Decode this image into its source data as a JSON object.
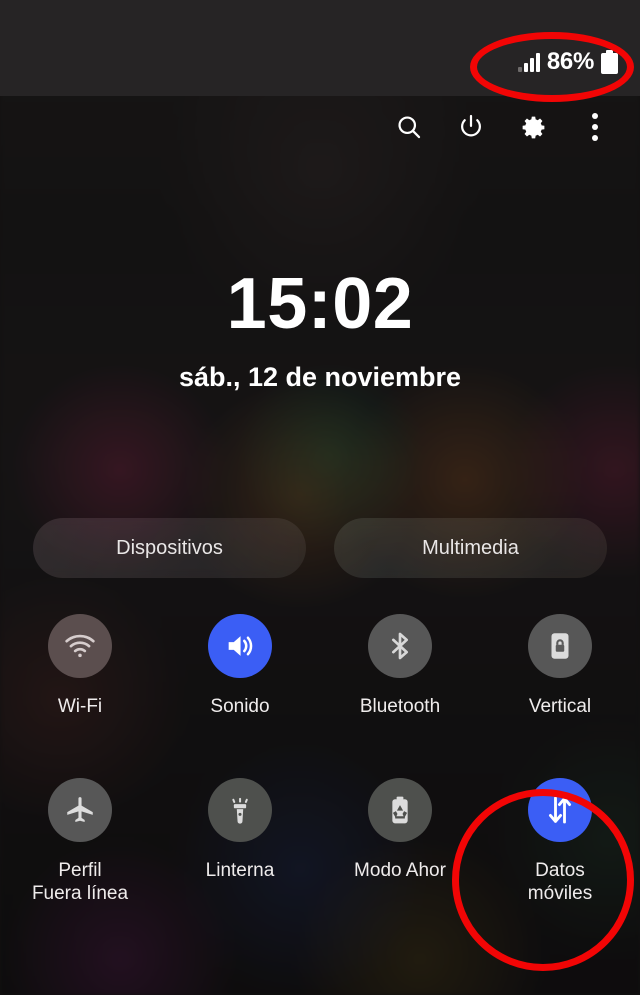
{
  "status_bar": {
    "signal_icon": "signal-bars-icon",
    "battery_percent": "86%",
    "battery_icon": "battery-full-icon"
  },
  "header": {
    "icons": [
      {
        "name": "search-icon",
        "label": "Buscar"
      },
      {
        "name": "power-icon",
        "label": "Apagar"
      },
      {
        "name": "gear-icon",
        "label": "Ajustes"
      },
      {
        "name": "more-options-icon",
        "label": "Más opciones"
      }
    ]
  },
  "clock": {
    "time": "15:02",
    "date": "sáb., 12 de noviembre"
  },
  "pills": [
    {
      "label": "Dispositivos",
      "name": "devices-pill"
    },
    {
      "label": "Multimedia",
      "name": "media-pill"
    }
  ],
  "quick_settings": [
    {
      "label": "Wi-Fi",
      "icon": "wifi-icon",
      "state": "off",
      "style": "warm"
    },
    {
      "label": "Sonido",
      "icon": "volume-icon",
      "state": "on",
      "style": "on"
    },
    {
      "label": "Bluetooth",
      "icon": "bluetooth-icon",
      "state": "off",
      "style": "cool"
    },
    {
      "label": "Vertical",
      "icon": "rotation-lock-icon",
      "state": "off",
      "style": "cool"
    },
    {
      "label": "Perfil\nFuera línea",
      "icon": "airplane-icon",
      "state": "off",
      "style": "cool"
    },
    {
      "label": "Linterna",
      "icon": "flashlight-icon",
      "state": "off",
      "style": "dark"
    },
    {
      "label": "Modo Ahor",
      "icon": "battery-saver-icon",
      "state": "off",
      "style": "dark"
    },
    {
      "label": "Datos\nmóviles",
      "icon": "mobile-data-icon",
      "state": "on",
      "style": "on"
    }
  ],
  "annotations": {
    "color": "#f20505",
    "items": [
      {
        "name": "battery-status-highlight",
        "shape": "ellipse"
      },
      {
        "name": "mobile-data-highlight",
        "shape": "circle"
      }
    ]
  }
}
